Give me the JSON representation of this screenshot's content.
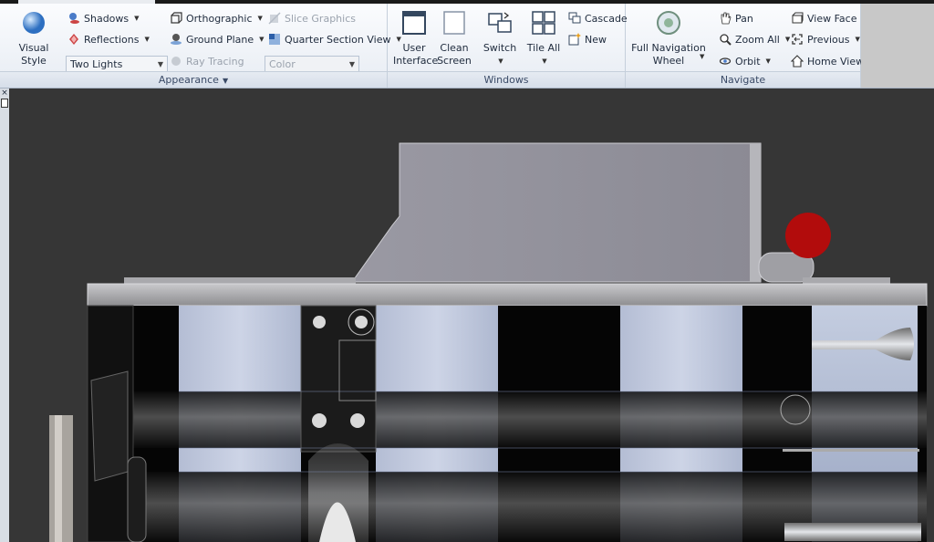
{
  "ribbon": {
    "appearance": {
      "label": "Appearance",
      "visual_style": "Visual Style",
      "shadows": "Shadows",
      "reflections": "Reflections",
      "lighting": "Two Lights",
      "orthographic": "Orthographic",
      "ground_plane": "Ground Plane",
      "ray_tracing": "Ray Tracing",
      "slice_graphics": "Slice Graphics",
      "quarter_section_view": "Quarter Section View",
      "color": "Color"
    },
    "windows": {
      "label": "Windows",
      "user_interface_1": "User",
      "user_interface_2": "Interface",
      "clean_screen_1": "Clean",
      "clean_screen_2": "Screen",
      "switch": "Switch",
      "tile_all": "Tile All",
      "cascade": "Cascade",
      "new": "New"
    },
    "navigate": {
      "label": "Navigate",
      "full_nav_wheel_1": "Full Navigation",
      "full_nav_wheel_2": "Wheel",
      "pan": "Pan",
      "zoom_all": "Zoom All",
      "orbit": "Orbit",
      "view_face": "View Face",
      "previous": "Previous",
      "home_view": "Home View"
    }
  }
}
